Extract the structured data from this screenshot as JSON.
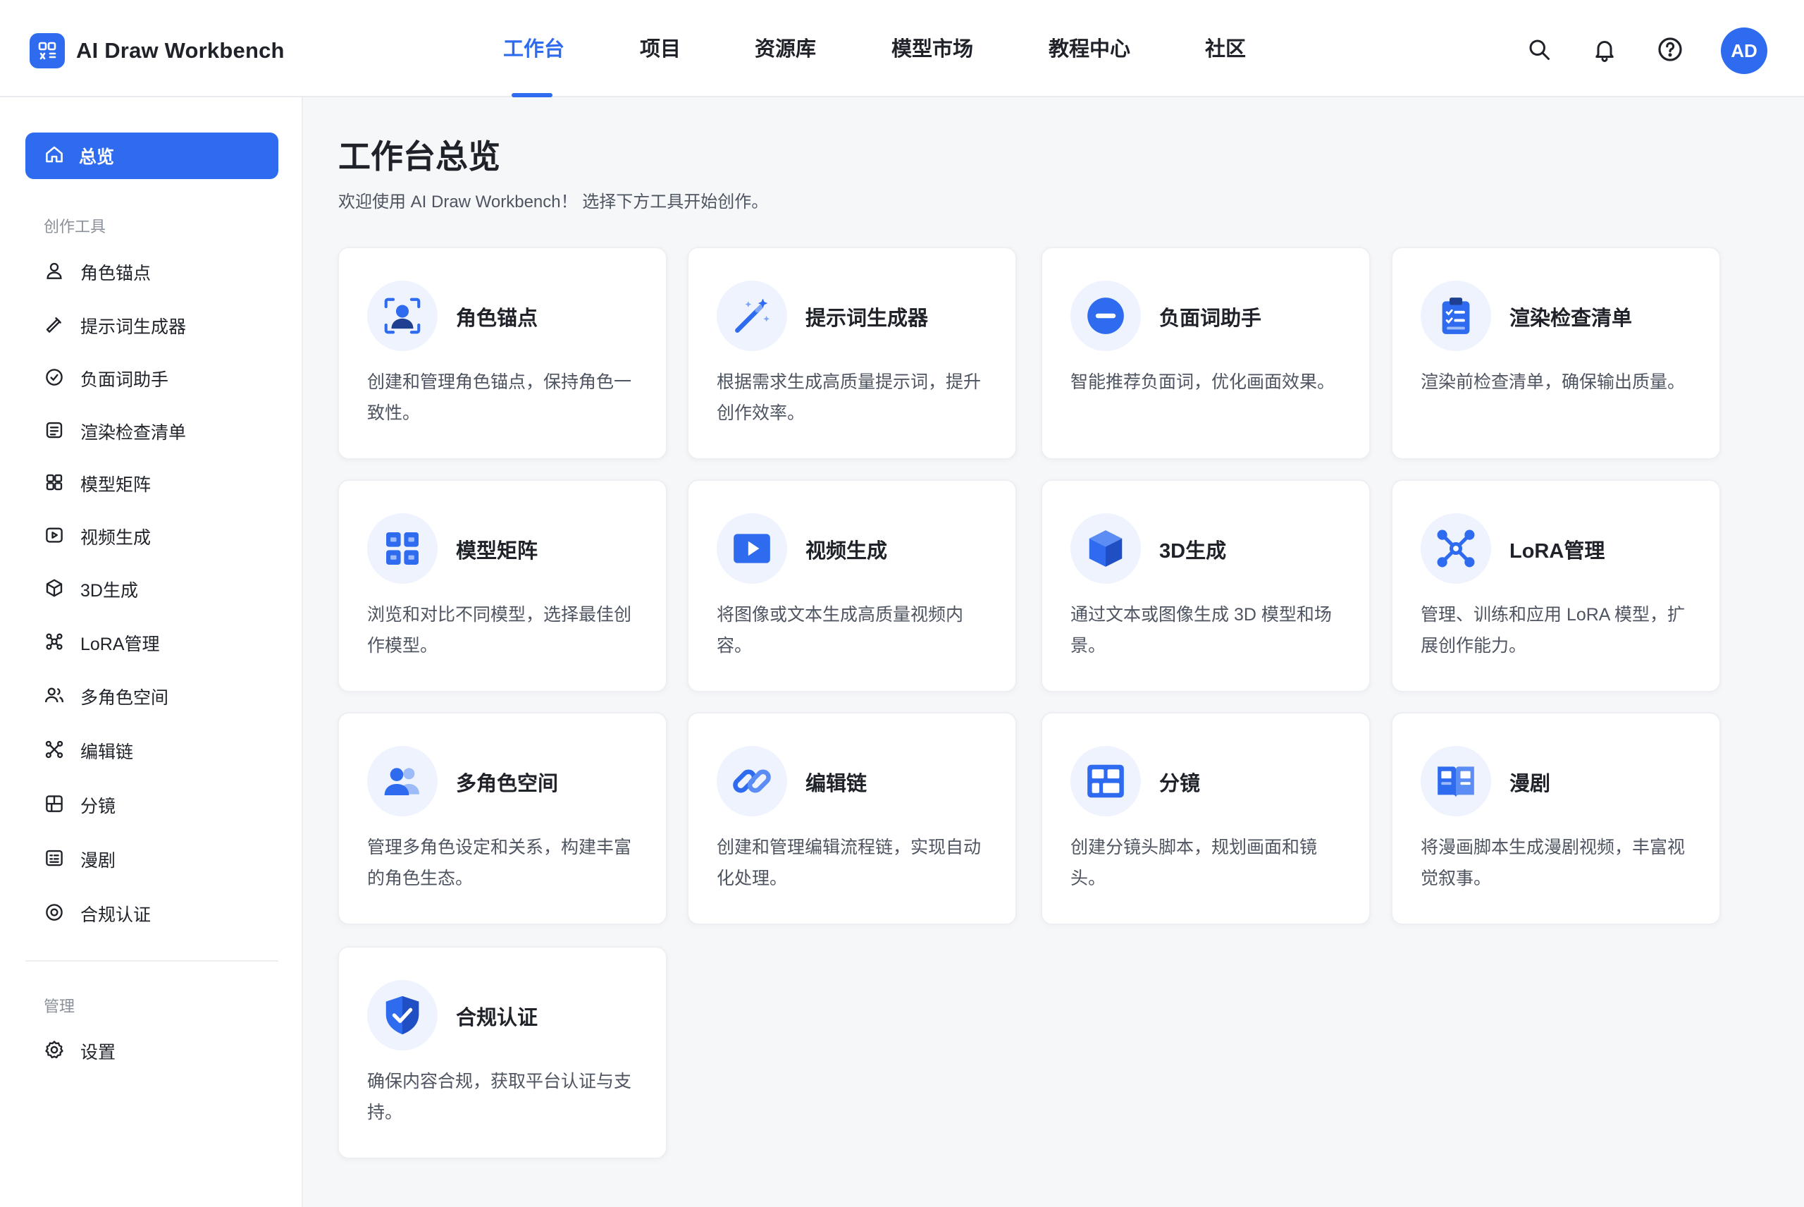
{
  "app": {
    "name": "AI Draw Workbench",
    "avatar_initials": "AD"
  },
  "nav": {
    "items": [
      {
        "label": "工作台",
        "active": true
      },
      {
        "label": "项目"
      },
      {
        "label": "资源库"
      },
      {
        "label": "模型市场"
      },
      {
        "label": "教程中心"
      },
      {
        "label": "社区"
      }
    ]
  },
  "topbar_icons": [
    "search-icon",
    "bell-icon",
    "help-icon"
  ],
  "sidebar": {
    "active": {
      "label": "总览",
      "icon": "home-icon"
    },
    "section_tools": "创作工具",
    "items": [
      {
        "label": "角色锚点",
        "icon": "user-icon"
      },
      {
        "label": "提示词生成器",
        "icon": "wand-icon"
      },
      {
        "label": "负面词助手",
        "icon": "clock-icon"
      },
      {
        "label": "渲染检查清单",
        "icon": "checklist-icon"
      },
      {
        "label": "模型矩阵",
        "icon": "grid-icon"
      },
      {
        "label": "视频生成",
        "icon": "video-icon"
      },
      {
        "label": "3D生成",
        "icon": "cube-icon"
      },
      {
        "label": "LoRA管理",
        "icon": "network-icon"
      },
      {
        "label": "多角色空间",
        "icon": "users-icon"
      },
      {
        "label": "编辑链",
        "icon": "chain-nodes-icon"
      },
      {
        "label": "分镜",
        "icon": "storyboard-icon"
      },
      {
        "label": "漫剧",
        "icon": "comic-icon"
      },
      {
        "label": "合规认证",
        "icon": "shield-icon"
      }
    ],
    "section_admin": "管理",
    "admin_items": [
      {
        "label": "设置",
        "icon": "gear-icon"
      }
    ]
  },
  "main": {
    "title": "工作台总览",
    "subtitle": "欢迎使用 AI Draw Workbench！ 选择下方工具开始创作。",
    "cards": [
      {
        "title": "角色锚点",
        "desc": "创建和管理角色锚点，保持角色一致性。",
        "icon": "user-focus-icon"
      },
      {
        "title": "提示词生成器",
        "desc": "根据需求生成高质量提示词，提升创作效率。",
        "icon": "magic-wand-icon"
      },
      {
        "title": "负面词助手",
        "desc": "智能推荐负面词，优化画面效果。",
        "icon": "minus-circle-icon"
      },
      {
        "title": "渲染检查清单",
        "desc": "渲染前检查清单，确保输出质量。",
        "icon": "clipboard-icon"
      },
      {
        "title": "模型矩阵",
        "desc": "浏览和对比不同模型，选择最佳创作模型。",
        "icon": "grid-icon"
      },
      {
        "title": "视频生成",
        "desc": "将图像或文本生成高质量视频内容。",
        "icon": "play-icon"
      },
      {
        "title": "3D生成",
        "desc": "通过文本或图像生成 3D 模型和场景。",
        "icon": "cube-icon"
      },
      {
        "title": "LoRA管理",
        "desc": "管理、训练和应用 LoRA 模型，扩展创作能力。",
        "icon": "network-icon"
      },
      {
        "title": "多角色空间",
        "desc": "管理多角色设定和关系，构建丰富的角色生态。",
        "icon": "users-icon"
      },
      {
        "title": "编辑链",
        "desc": "创建和管理编辑流程链，实现自动化处理。",
        "icon": "link-icon"
      },
      {
        "title": "分镜",
        "desc": "创建分镜头脚本，规划画面和镜头。",
        "icon": "storyboard-icon"
      },
      {
        "title": "漫剧",
        "desc": "将漫画脚本生成漫剧视频，丰富视觉叙事。",
        "icon": "book-icon"
      },
      {
        "title": "合规认证",
        "desc": "确保内容合规，获取平台认证与支持。",
        "icon": "shield-check-icon"
      }
    ]
  },
  "colors": {
    "accent": "#2f6bef",
    "icon_bg": "#eef3fe",
    "text": "#1f2329",
    "muted": "#4e5561"
  }
}
